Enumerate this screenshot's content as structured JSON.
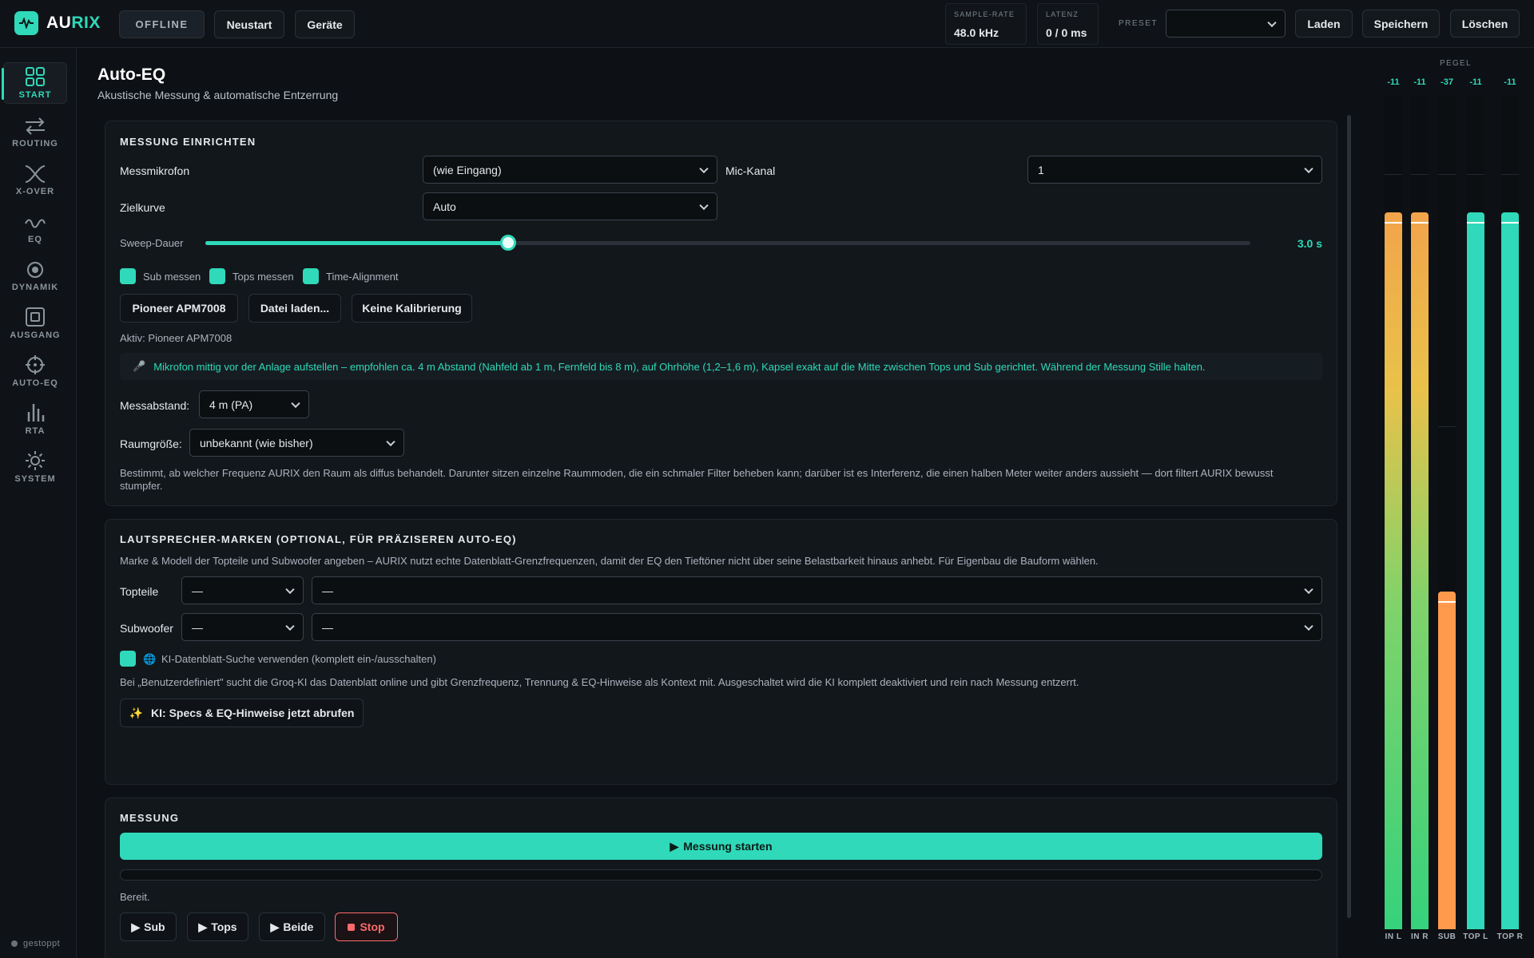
{
  "app": {
    "logo_prefix": "AU",
    "logo_suffix": "RIX",
    "status": "OFFLINE",
    "restart": "Neustart",
    "devices": "Geräte"
  },
  "stats": [
    {
      "label": "SAMPLE-RATE",
      "value": "48.0 kHz"
    },
    {
      "label": "LATENZ",
      "value": "0 / 0 ms"
    }
  ],
  "preset": {
    "label": "PRESET",
    "value": "",
    "load": "Laden",
    "save": "Speichern",
    "delete": "Löschen"
  },
  "sidebar": {
    "items": [
      {
        "label": "START",
        "icon": "grid-icon",
        "active": true
      },
      {
        "label": "ROUTING",
        "icon": "arrows-icon"
      },
      {
        "label": "X-OVER",
        "icon": "crossover-icon"
      },
      {
        "label": "EQ",
        "icon": "wave-icon"
      },
      {
        "label": "DYNAMIK",
        "icon": "target-icon"
      },
      {
        "label": "AUSGANG",
        "icon": "output-icon"
      },
      {
        "label": "AUTO-EQ",
        "icon": "crosshair-icon"
      },
      {
        "label": "RTA",
        "icon": "bars-icon"
      },
      {
        "label": "SYSTEM",
        "icon": "sun-icon"
      }
    ],
    "status": "gestoppt"
  },
  "page": {
    "title": "Auto-EQ",
    "subtitle": "Akustische Messung & automatische Entzerrung"
  },
  "setup": {
    "title": "MESSUNG EINRICHTEN",
    "mic_label": "Messmikrofon",
    "mic_value": "(wie Eingang)",
    "channel_label": "Mic-Kanal",
    "channel_value": "1",
    "curve_label": "Zielkurve",
    "curve_value": "Auto",
    "sweep_label": "Sweep-Dauer",
    "sweep_value": "3.0 s",
    "sweep_fraction": 0.29,
    "checks": [
      "Sub messen",
      "Tops messen",
      "Time-Alignment"
    ],
    "cal_buttons": [
      "Pioneer APM7008",
      "Datei laden...",
      "Keine Kalibrierung"
    ],
    "active": "Aktiv: Pioneer APM7008",
    "hint": "Mikrofon mittig vor der Anlage aufstellen – empfohlen ca. 4 m Abstand (Nahfeld ab 1 m, Fernfeld bis 8 m), auf Ohrhöhe (1,2–1,6 m), Kapsel exakt auf die Mitte zwischen Tops und Sub gerichtet. Während der Messung Stille halten.",
    "distance_label": "Messabstand:",
    "distance_value": "4 m (PA)",
    "room_label": "Raumgröße:",
    "room_value": "unbekannt (wie bisher)",
    "room_note": "Bestimmt, ab welcher Frequenz AURIX den Raum als diffus behandelt. Darunter sitzen einzelne Raummoden, die ein schmaler Filter beheben kann; darüber ist es Interferenz, die einen halben Meter weiter anders aussieht — dort filtert AURIX bewusst stumpfer."
  },
  "speakers": {
    "title": "LAUTSPRECHER-MARKEN (OPTIONAL, FÜR PRÄZISEREN AUTO-EQ)",
    "desc": "Marke & Modell der Topteile und Subwoofer angeben – AURIX nutzt echte Datenblatt-Grenzfrequenzen, damit der EQ den Tieftöner nicht über seine Belastbarkeit hinaus anhebt. Für Eigenbau die Bauform wählen.",
    "tops_label": "Topteile",
    "tops_brand": "—",
    "tops_model": "—",
    "sub_label": "Subwoofer",
    "sub_brand": "—",
    "sub_model": "—",
    "ai_toggle": "KI-Datenblatt-Suche verwenden (komplett ein-/ausschalten)",
    "ai_note": "Bei „Benutzerdefiniert\" sucht die Groq-KI das Datenblatt online und gibt Grenzfrequenz, Trennung & EQ-Hinweise als Kontext mit. Ausgeschaltet wird die KI komplett deaktiviert und rein nach Messung entzerrt.",
    "ai_button": "KI: Specs & EQ-Hinweise jetzt abrufen"
  },
  "measure": {
    "title": "MESSUNG",
    "start": "Messung starten",
    "status": "Bereit.",
    "progress": 0,
    "buttons": [
      "Sub",
      "Tops",
      "Beide"
    ],
    "stop": "Stop"
  },
  "meters": {
    "title": "PEGEL",
    "channels": [
      {
        "label": "IN L",
        "value": "-11",
        "level": 0.86,
        "color": "orange-green"
      },
      {
        "label": "IN R",
        "value": "-11",
        "level": 0.86,
        "color": "orange-green"
      },
      {
        "label": "SUB",
        "value": "-37",
        "level": 0.405,
        "color": "#ff9a4d"
      },
      {
        "label": "TOP L",
        "value": "-11",
        "level": 0.86,
        "color": "#2fd9b9"
      },
      {
        "label": "TOP R",
        "value": "-11",
        "level": 0.86,
        "color": "#2fd9b9"
      }
    ]
  },
  "colors": {
    "accent": "#2fd9b9",
    "bg": "#0d1014",
    "stop": "#ff6b6b"
  }
}
